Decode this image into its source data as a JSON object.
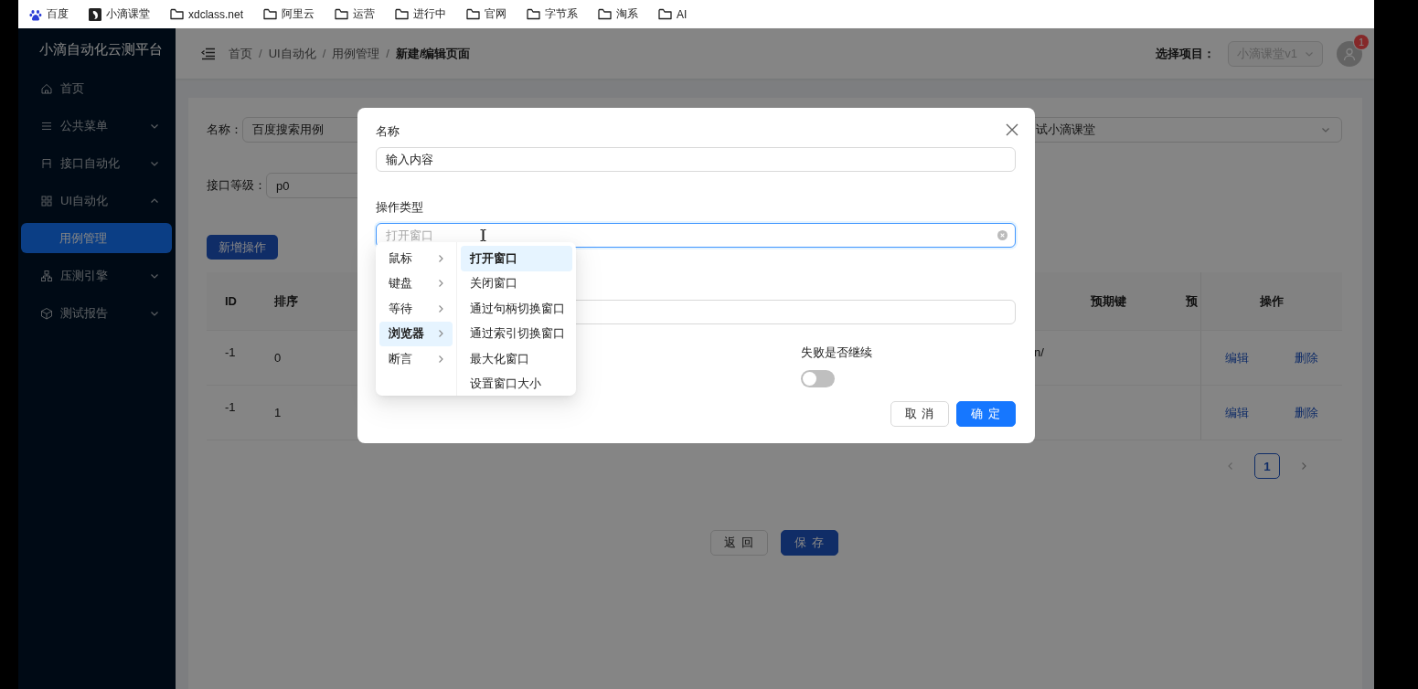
{
  "bookmarks": [
    {
      "label": "百度",
      "kind": "paw"
    },
    {
      "label": "小滴课堂",
      "kind": "logo"
    },
    {
      "label": "xdclass.net",
      "kind": "folder"
    },
    {
      "label": "阿里云",
      "kind": "folder"
    },
    {
      "label": "运营",
      "kind": "folder"
    },
    {
      "label": "进行中",
      "kind": "folder"
    },
    {
      "label": "官网",
      "kind": "folder"
    },
    {
      "label": "字节系",
      "kind": "folder"
    },
    {
      "label": "淘系",
      "kind": "folder"
    },
    {
      "label": "AI",
      "kind": "folder"
    }
  ],
  "sidebar": {
    "title": "小滴自动化云测平台",
    "items": [
      {
        "label": "首页",
        "kind": "link"
      },
      {
        "label": "公共菜单",
        "kind": "group",
        "expanded": false
      },
      {
        "label": "接口自动化",
        "kind": "group",
        "expanded": false
      },
      {
        "label": "UI自动化",
        "kind": "group",
        "expanded": true,
        "children": [
          {
            "label": "用例管理",
            "selected": true
          }
        ]
      },
      {
        "label": "压测引擎",
        "kind": "group",
        "expanded": false
      },
      {
        "label": "测试报告",
        "kind": "group",
        "expanded": false
      }
    ]
  },
  "header": {
    "breadcrumb": [
      {
        "label": "首页",
        "current": false
      },
      {
        "label": "UI自动化",
        "current": false
      },
      {
        "label": "用例管理",
        "current": false
      },
      {
        "label": "新建/编辑页面",
        "current": true
      }
    ],
    "breadcrumb_separators": [
      "/",
      "/",
      "/"
    ],
    "project_label": "选择项目：",
    "project": {
      "value": "小滴课堂v1",
      "disabled": true
    },
    "notification_count": "1"
  },
  "form": {
    "name": {
      "label": "名称：",
      "value": "百度搜索用例"
    },
    "project": {
      "value": "试小滴课堂"
    },
    "level": {
      "label": "接口等级：",
      "value": "p0"
    }
  },
  "add_button": "新增操作",
  "table": {
    "columns": [
      "ID",
      "排序",
      "预期键",
      "预"
    ],
    "action_column": "操作",
    "rows": [
      {
        "id": "-1",
        "order": "0",
        "column_3": "n/",
        "actions": [
          "编辑",
          "删除"
        ]
      },
      {
        "id": "-1",
        "order": "1",
        "actions": [
          "编辑",
          "删除"
        ]
      }
    ]
  },
  "pagination": {
    "pages": [
      {
        "label": "1",
        "selected": true
      }
    ]
  },
  "footer_buttons": [
    {
      "label": "返 回",
      "primary": false
    },
    {
      "label": "保 存",
      "primary": true
    }
  ],
  "modal": {
    "fields": [
      {
        "kind": "text",
        "label": "名称",
        "value": "输入内容"
      },
      {
        "kind": "select",
        "label": "操作类型",
        "placeholder": "打开窗口",
        "focused": true
      },
      {
        "kind": "text"
      }
    ],
    "switches": [
      {
        "label": "失败是否继续",
        "on": false
      }
    ],
    "buttons": [
      {
        "label": "取 消",
        "primary": false
      },
      {
        "label": "确 定",
        "primary": true
      }
    ]
  },
  "cascader": {
    "columns": [
      {
        "kind": "parent",
        "items": [
          {
            "label": "鼠标",
            "selected": false
          },
          {
            "label": "键盘",
            "selected": false
          },
          {
            "label": "等待",
            "selected": false
          },
          {
            "label": "浏览器",
            "selected": true
          },
          {
            "label": "断言",
            "selected": false
          }
        ]
      },
      {
        "kind": "leaf",
        "items": [
          {
            "label": "打开窗口",
            "selected": true
          },
          {
            "label": "关闭窗口",
            "selected": false
          },
          {
            "label": "通过句柄切换窗口",
            "selected": false
          },
          {
            "label": "通过索引切换窗口",
            "selected": false
          },
          {
            "label": "最大化窗口",
            "selected": false
          },
          {
            "label": "设置窗口大小",
            "selected": false
          }
        ]
      }
    ]
  }
}
